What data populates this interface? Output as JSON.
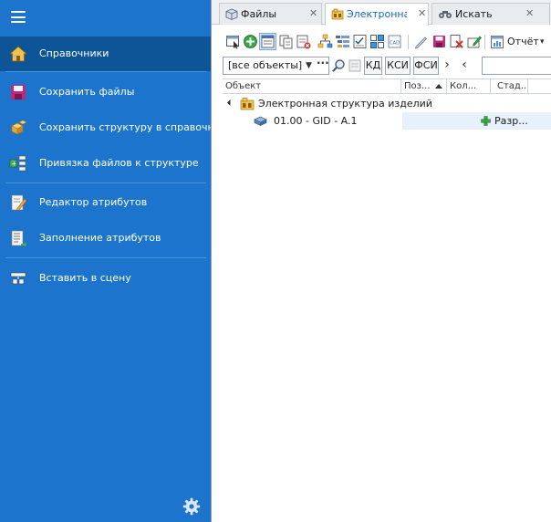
{
  "sidebar": {
    "menu_icon": "hamburger-menu-icon",
    "items": [
      {
        "label": "Справочники",
        "icon": "house-icon",
        "active": true
      },
      {
        "label": "Сохранить файлы",
        "icon": "floppy-disk-icon"
      },
      {
        "label": "Сохранить структуру в справочник",
        "icon": "boxes-icon"
      },
      {
        "label": "Привязка файлов к структуре",
        "icon": "link-files-icon"
      },
      {
        "label": "Редактор атрибутов",
        "icon": "edit-document-icon"
      },
      {
        "label": "Заполнение атрибутов",
        "icon": "fill-document-icon"
      },
      {
        "label": "Вставить в сцену",
        "icon": "insert-scene-icon"
      }
    ],
    "settings_icon": "gear-icon"
  },
  "tabs": [
    {
      "label": "Файлы",
      "icon": "cube-icon",
      "close": "✕"
    },
    {
      "label": "Электронная с",
      "icon": "structure-icon",
      "close": "✕",
      "active": true
    },
    {
      "label": "Искать",
      "icon": "binoculars-icon",
      "close": "✕"
    }
  ],
  "toolbar": {
    "report_label": "Отчёт",
    "report_suffix": "▾"
  },
  "filter": {
    "objects_value": "[все объекты]",
    "combo_arrow": "▼",
    "combo_dots": "···",
    "kd_label": "КД",
    "ksi_label": "КСИ",
    "fsi_label": "ФСИ",
    "next_arrow": "›",
    "prev_arrow": "‹"
  },
  "grid": {
    "columns": [
      "Объект",
      "Поз...",
      "Кол...",
      "Стад..."
    ],
    "tree": [
      {
        "label": "Электронная структура изделий",
        "icon": "structure-folder-icon",
        "expanded": true
      },
      {
        "label": "01.00 - GID - A.1",
        "icon": "part-icon",
        "status_icon": "green-plus-icon",
        "stage": "Разр..."
      }
    ]
  },
  "colors": {
    "sidebar_bg": "#1c74cc",
    "sidebar_active": "#0d5597",
    "tab_active_text": "#1565c0",
    "row_highlight": "#e6f1fc"
  }
}
